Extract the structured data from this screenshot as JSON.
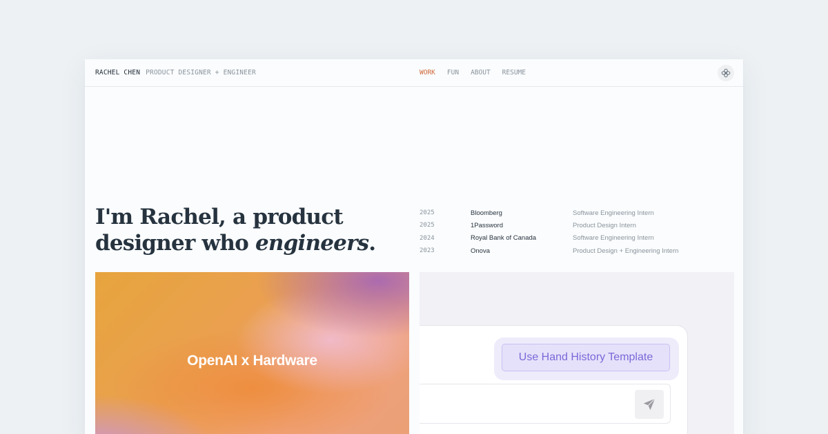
{
  "header": {
    "name": "RACHEL CHEN",
    "role": "PRODUCT DESIGNER + ENGINEER",
    "nav": [
      {
        "label": "WORK",
        "active": true
      },
      {
        "label": "FUN",
        "active": false
      },
      {
        "label": "ABOUT",
        "active": false
      },
      {
        "label": "RESUME",
        "active": false
      }
    ],
    "theme_icon": "flower-icon"
  },
  "hero": {
    "line1": "I'm Rachel, a product",
    "line2_prefix": "designer who ",
    "line2_emphasis": "engineers",
    "line2_suffix": "."
  },
  "experience": [
    {
      "year": "2025",
      "company": "Bloomberg",
      "role": "Software Engineering Intern"
    },
    {
      "year": "2025",
      "company": "1Password",
      "role": "Product Design Intern"
    },
    {
      "year": "2024",
      "company": "Royal Bank of Canada",
      "role": "Software Engineering Intern"
    },
    {
      "year": "2023",
      "company": "Onova",
      "role": "Product Design + Engineering Intern"
    }
  ],
  "projects": {
    "left_title": "OpenAI x Hardware",
    "right_button": "Use Hand History Template",
    "send_icon": "send-icon"
  },
  "colors": {
    "accent": "#d06a3a",
    "text": "#26333f",
    "muted": "#8a939c",
    "purple": "#7a68d8",
    "background": "#edf1f4"
  }
}
